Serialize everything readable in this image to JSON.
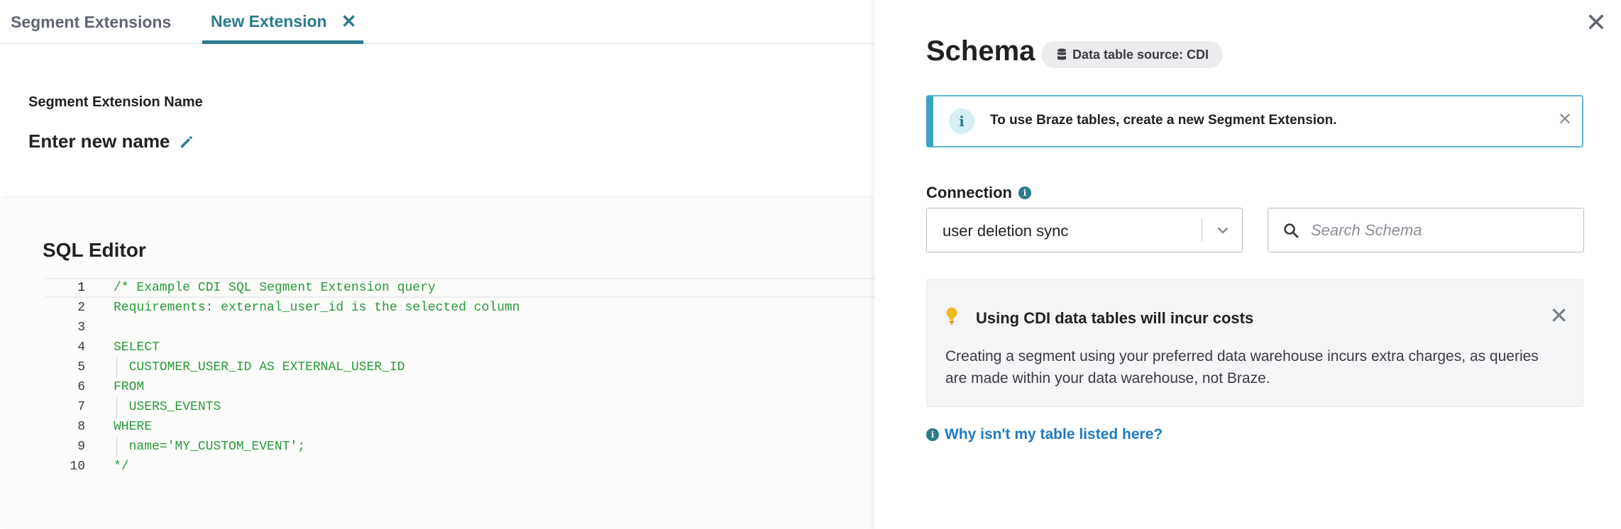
{
  "tabs": [
    {
      "label": "Segment Extensions"
    },
    {
      "label": "New Extension",
      "close": "✕"
    }
  ],
  "name_section": {
    "label": "Segment Extension Name",
    "value": "Enter new name"
  },
  "sql_editor": {
    "title": "SQL Editor",
    "lines": [
      {
        "number": "1",
        "text": "/* Example CDI SQL Segment Extension query"
      },
      {
        "number": "2",
        "text": "Requirements: external_user_id is the selected column"
      },
      {
        "number": "3",
        "text": ""
      },
      {
        "number": "4",
        "text": "SELECT"
      },
      {
        "number": "5",
        "text": "  CUSTOMER_USER_ID AS EXTERNAL_USER_ID"
      },
      {
        "number": "6",
        "text": "FROM"
      },
      {
        "number": "7",
        "text": "  USERS_EVENTS"
      },
      {
        "number": "8",
        "text": "WHERE"
      },
      {
        "number": "9",
        "text": "  name='MY_CUSTOM_EVENT';"
      },
      {
        "number": "10",
        "text": "*/"
      }
    ]
  },
  "schema_panel": {
    "close": "✕",
    "title": "Schema",
    "source_badge": "Data table source: CDI",
    "info_banner": {
      "icon": "i",
      "text": "To use Braze tables, create a new Segment Extension.",
      "close": "✕"
    },
    "connection": {
      "label": "Connection",
      "info_icon": "i",
      "selected": "user deletion sync"
    },
    "search": {
      "placeholder": "Search Schema"
    },
    "cost_notice": {
      "title": "Using CDI data tables will incur costs",
      "close": "✕",
      "body": "Creating a segment using your preferred data warehouse incurs extra charges, as queries are made within your data warehouse, not Braze."
    },
    "help_link": {
      "icon": "i",
      "text": "Why isn't my table listed here?"
    }
  },
  "colors": {
    "accent": "#2b7a8c",
    "code_green": "#2a9a39",
    "link_blue": "#1f7ac4",
    "info_border": "#3aa3bd"
  }
}
